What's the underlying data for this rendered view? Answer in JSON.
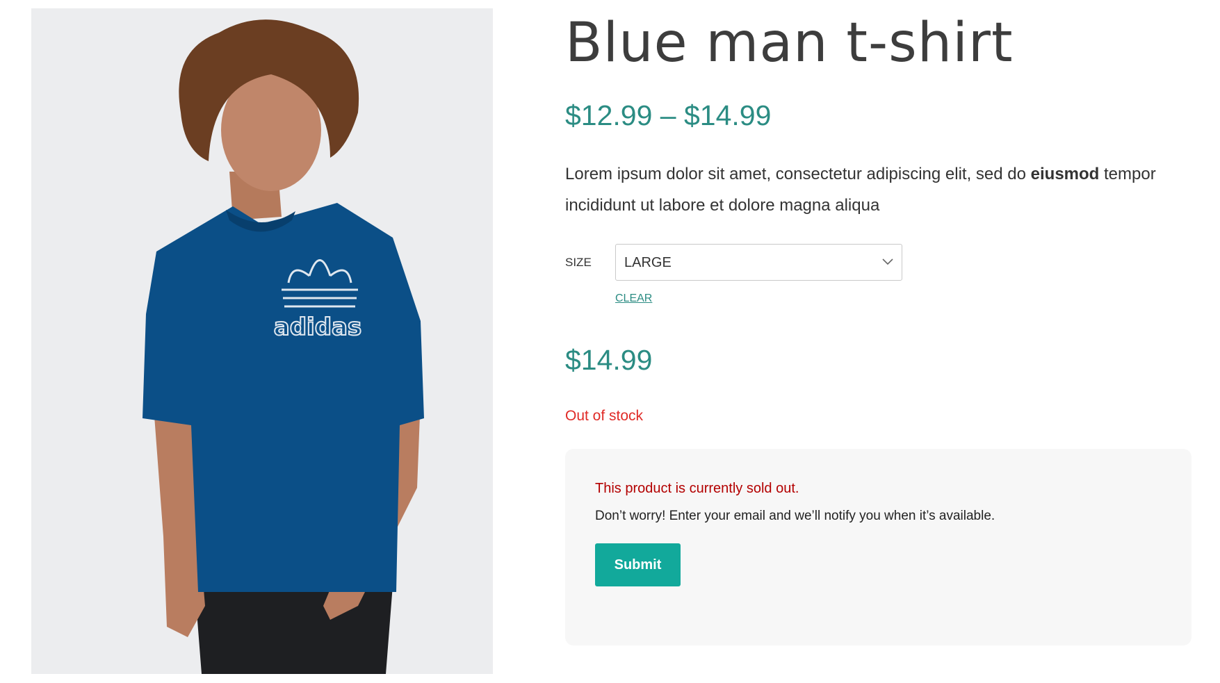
{
  "product": {
    "title": "Blue man t-shirt",
    "price_range": "$12.99 – $14.99",
    "description": {
      "before_bold": "Lorem ipsum dolor sit amet, consectetur adipiscing elit, sed do ",
      "bold": "eiusmod",
      "after_bold": " tempor incididunt ut labore et dolore magna aliqua"
    },
    "image_icon": "tshirt-photo",
    "logo_text": "adidas"
  },
  "variation": {
    "size_label": "SIZE",
    "size_selected": "LARGE",
    "clear_label": "CLEAR",
    "dropdown_icon": "chevron-down-icon"
  },
  "selected_price": "$14.99",
  "stock_status": "Out of stock",
  "notify": {
    "title": "This product is currently sold out.",
    "message": "Don’t worry! Enter your email and we’ll notify you when it’s available.",
    "submit_label": "Submit"
  },
  "colors": {
    "accent": "#2b8c83",
    "button": "#12a99b",
    "out_of_stock": "#e02b27",
    "sold_out_title": "#b30000",
    "shirt": "#0b4f87"
  }
}
